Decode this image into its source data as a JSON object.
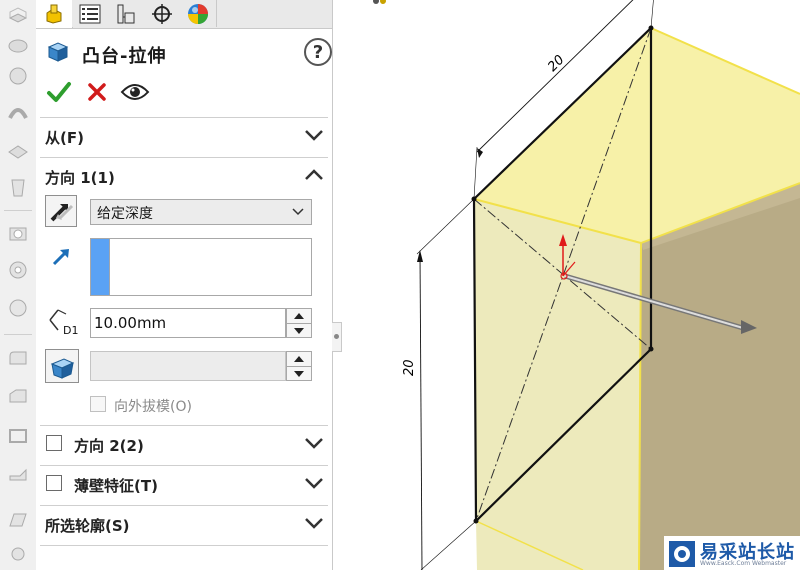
{
  "feature": {
    "title": "凸台-拉伸"
  },
  "sections": {
    "from": {
      "label": "从(F)"
    },
    "direction1": {
      "label": "方向 1(1)"
    },
    "direction2": {
      "label": "方向 2(2)"
    },
    "thin_feature": {
      "label": "薄壁特征(T)"
    },
    "selected_contours": {
      "label": "所选轮廓(S)"
    }
  },
  "direction1": {
    "end_condition": "给定深度",
    "depth": "10.00mm",
    "depth_icon_label": "D1",
    "draft_outward_label": "向外拔模(O)"
  },
  "viewport": {
    "dimension_top": "20",
    "dimension_left": "20"
  },
  "watermark": {
    "text": "易采站长站",
    "subtext": "Www.Easck.Com Webmaster"
  },
  "colors": {
    "accent_selection": "#5aa2f4",
    "ok_green": "#2e9e2e",
    "cancel_red": "#d11b1b",
    "preview_face": "#f2efbf",
    "side_face": "#b8ab86"
  }
}
